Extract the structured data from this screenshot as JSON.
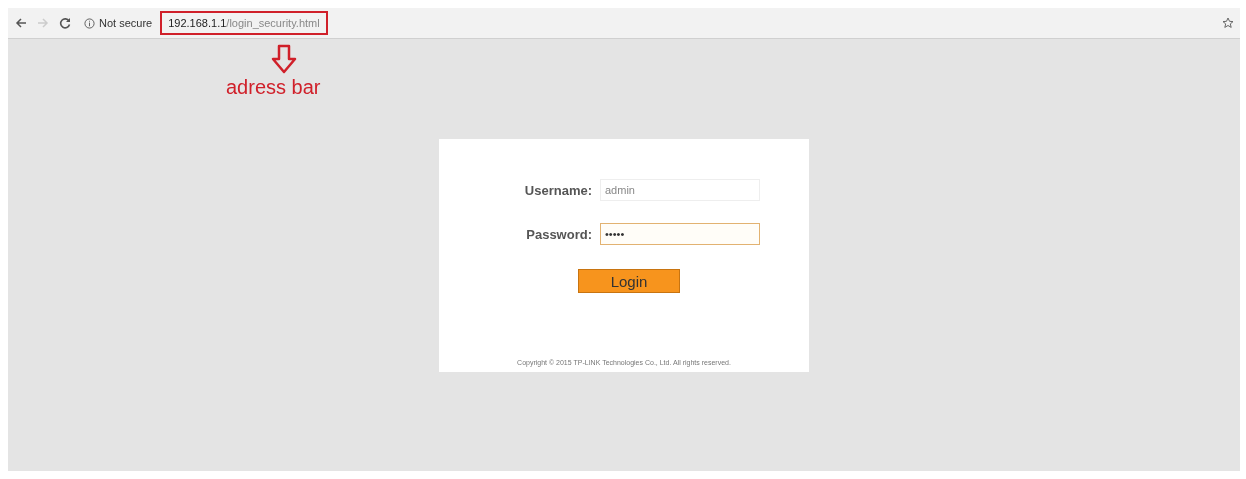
{
  "browser": {
    "security_label": "Not secure",
    "url_host": "192.168.1.1",
    "url_path": "/login_security.html",
    "highlighted": true
  },
  "annotation": {
    "label": "adress bar"
  },
  "login_form": {
    "fields": [
      {
        "label": "Username:",
        "value": "admin",
        "focused": false
      },
      {
        "label": "Password:",
        "value": "•••••",
        "focused": true
      }
    ],
    "login_button": "Login",
    "copyright": "Copyright © 2015 TP-LINK Technologies Co., Ltd. All rights reserved."
  }
}
